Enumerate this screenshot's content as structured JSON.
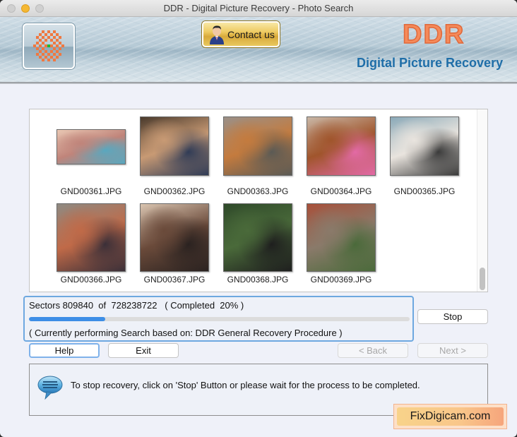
{
  "window": {
    "title": "DDR - Digital Picture Recovery - Photo Search"
  },
  "banner": {
    "contact_label": "Contact us",
    "brand_name": "DDR",
    "brand_subtitle": "Digital Picture Recovery"
  },
  "thumbnails": [
    {
      "filename": "GND00361.JPG",
      "colors": [
        "#e9c7b3",
        "#c0847a",
        "#58a8c0"
      ]
    },
    {
      "filename": "GND00362.JPG",
      "colors": [
        "#4a3a2c",
        "#c89a74",
        "#2f3b56"
      ]
    },
    {
      "filename": "GND00363.JPG",
      "colors": [
        "#9a9088",
        "#c47b3e",
        "#5a5a55"
      ]
    },
    {
      "filename": "GND00364.JPG",
      "colors": [
        "#c9b7a6",
        "#a0552c",
        "#e36aa6"
      ]
    },
    {
      "filename": "GND00365.JPG",
      "colors": [
        "#8aa9b8",
        "#e9e4de",
        "#3a3a3a"
      ]
    },
    {
      "filename": "GND00366.JPG",
      "colors": [
        "#8e8a82",
        "#c06a48",
        "#3a2f38"
      ]
    },
    {
      "filename": "GND00367.JPG",
      "colors": [
        "#d9c4b0",
        "#6a4a3a",
        "#2a2220"
      ]
    },
    {
      "filename": "GND00368.JPG",
      "colors": [
        "#2f4a2a",
        "#4a6a3a",
        "#1e1e1e"
      ]
    },
    {
      "filename": "GND00369.JPG",
      "colors": [
        "#a8503a",
        "#8a7a6a",
        "#4a6a3a"
      ]
    }
  ],
  "progress": {
    "status_text": "Sectors 809840  of  728238722   ( Completed  20% )",
    "sectors_done": 809840,
    "sectors_total": 728238722,
    "percent_complete": 20,
    "procedure_text": "( Currently performing Search based on: DDR General Recovery Procedure )"
  },
  "buttons": {
    "stop": "Stop",
    "help": "Help",
    "exit": "Exit",
    "back": "< Back",
    "next": "Next >"
  },
  "info": {
    "message": "To stop recovery, click on 'Stop' Button or please wait for the process to be completed."
  },
  "watermark": {
    "text": "FixDigicam.com"
  }
}
